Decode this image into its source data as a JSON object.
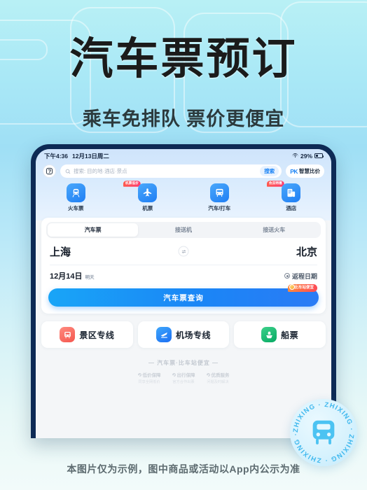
{
  "hero": {
    "title": "汽车票预订",
    "subtitle": "乘车免排队 票价更便宜"
  },
  "phone": {
    "status_bar": {
      "time": "下午4:36",
      "date": "12月13日周二",
      "battery": "29%",
      "wifi_icon": "wifi-icon",
      "battery_icon": "battery-icon"
    },
    "search": {
      "scan_icon": "scan-icon",
      "magnifier_icon": "search-icon",
      "placeholder": "搜索: 目的地·酒店·景点",
      "value": "",
      "go_label": "搜索",
      "pk_mark": "PK",
      "pk_label": "智慧比价"
    },
    "categories": [
      {
        "label": "火车票",
        "icon": "train-icon",
        "badge": ""
      },
      {
        "label": "机票",
        "icon": "plane-icon",
        "badge": "机票低价"
      },
      {
        "label": "汽车/打车",
        "icon": "bus-icon",
        "badge": ""
      },
      {
        "label": "酒店",
        "icon": "hotel-icon",
        "badge": "会员特惠"
      }
    ],
    "tabs": [
      {
        "label": "汽车票",
        "active": true
      },
      {
        "label": "接送机",
        "active": false
      },
      {
        "label": "接送火车",
        "active": false
      }
    ],
    "trip": {
      "from_city": "上海",
      "to_city": "北京",
      "swap_icon": "swap-icon",
      "date": "12月14日",
      "date_note": "明天",
      "return_label": "返程日期",
      "return_icon": "circle-plus-icon"
    },
    "search_button": {
      "label": "汽车票查询",
      "badge": "比车站便宜",
      "badge_icon": "coin-icon"
    },
    "quick_services": [
      {
        "label": "景区专线",
        "icon": "bus-icon",
        "color": "#f4564e"
      },
      {
        "label": "机场专线",
        "icon": "plane-transfer-icon",
        "color": "#1b6ef3"
      },
      {
        "label": "船票",
        "icon": "ship-icon",
        "color": "#06a963"
      }
    ],
    "trust": {
      "title": "— 汽车票·比车站便宜 —",
      "items": [
        {
          "label": "低价保障",
          "sub": "同享全网低价"
        },
        {
          "label": "出行保障",
          "sub": "官方合作出票"
        },
        {
          "label": "优质服务",
          "sub": "问题及时解决"
        }
      ]
    }
  },
  "seal": {
    "text": "ZHIXING · ZHIXING · ZHIXING · ZHIXING ·",
    "icon": "bus-icon"
  },
  "disclaimer": "本图片仅为示例，图中商品或活动以App内公示为准",
  "colors": {
    "accent": "#1a86f6",
    "badge_red": "#fd3b6e",
    "seal_blue": "#3fb8ee"
  }
}
